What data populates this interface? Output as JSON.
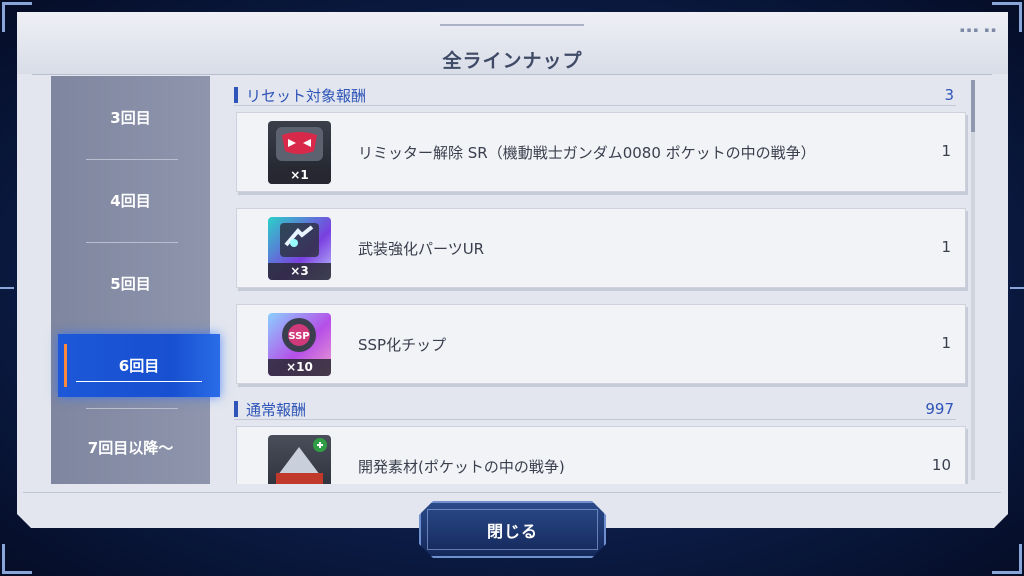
{
  "dialog": {
    "title": "全ラインナップ"
  },
  "sidebar": {
    "items": [
      {
        "label": "3回目",
        "active": false
      },
      {
        "label": "4回目",
        "active": false
      },
      {
        "label": "5回目",
        "active": false
      },
      {
        "label": "6回目",
        "active": true
      },
      {
        "label": "7回目以降〜",
        "active": false
      }
    ]
  },
  "sections": [
    {
      "label": "リセット対象報酬",
      "count": "3",
      "items": [
        {
          "name": "リミッター解除 SR（機動戦士ガンダム0080 ポケットの中の戦争）",
          "qty": "1",
          "icon": "limiter-release-sr-icon",
          "multiplier": "×1"
        },
        {
          "name": "武装強化パーツUR",
          "qty": "1",
          "icon": "weapon-upgrade-parts-ur-icon",
          "multiplier": "×3"
        },
        {
          "name": "SSP化チップ",
          "qty": "1",
          "icon": "ssp-chip-icon",
          "multiplier": "×10"
        }
      ]
    },
    {
      "label": "通常報酬",
      "count": "997",
      "items": [
        {
          "name": "開発素材(ポケットの中の戦争)",
          "qty": "10",
          "icon": "development-material-icon",
          "multiplier": ""
        }
      ]
    }
  ],
  "footer": {
    "close_label": "閉じる"
  },
  "colors": {
    "accent": "#2f55b8",
    "active_tab": "#1c58d8",
    "active_marker": "#ff8a3c"
  }
}
